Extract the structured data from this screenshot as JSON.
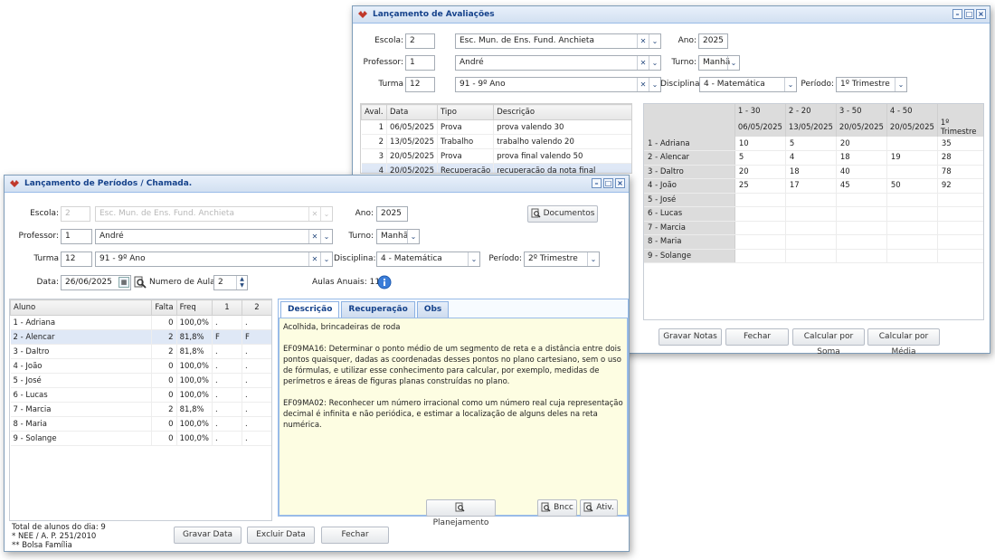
{
  "avaliacoes": {
    "title": "Lançamento de Avaliações",
    "escola_label": "Escola:",
    "escola_id": "2",
    "escola_name": "Esc. Mun. de Ens. Fund. Anchieta",
    "ano_label": "Ano:",
    "ano": "2025",
    "professor_label": "Professor:",
    "professor_id": "1",
    "professor_name": "André",
    "turno_label": "Turno:",
    "turno": "Manhã",
    "turma_label": "Turma",
    "turma_id": "12",
    "turma_name": "91 - 9º Ano",
    "disciplina_label": "Disciplina:",
    "disciplina": "4 - Matemática",
    "periodo_label": "Período:",
    "periodo": "1º Trimestre",
    "eval_headers": [
      "Aval.",
      "Data",
      "Tipo",
      "Descrição"
    ],
    "evals": [
      {
        "n": "1",
        "data": "06/05/2025",
        "tipo": "Prova",
        "desc": "prova valendo 30"
      },
      {
        "n": "2",
        "data": "13/05/2025",
        "tipo": "Trabalho",
        "desc": "trabalho valendo 20"
      },
      {
        "n": "3",
        "data": "20/05/2025",
        "tipo": "Prova",
        "desc": "prova final valendo 50"
      },
      {
        "n": "4",
        "data": "20/05/2025",
        "tipo": "Recuperação",
        "desc": "recuperação da nota final"
      }
    ],
    "grade_head1": [
      "1 - 30",
      "2 - 20",
      "3 - 50",
      "4 - 50",
      ""
    ],
    "grade_head2": [
      "06/05/2025",
      "13/05/2025",
      "20/05/2025",
      "20/05/2025",
      "1º Trimestre"
    ],
    "grades": [
      {
        "aluno": "1 - Adriana",
        "v": [
          "10",
          "5",
          "20",
          "",
          "35"
        ]
      },
      {
        "aluno": "2 - Alencar",
        "v": [
          "5",
          "4",
          "18",
          "19",
          "28"
        ]
      },
      {
        "aluno": "3 - Daltro",
        "v": [
          "20",
          "18",
          "40",
          "",
          "78"
        ]
      },
      {
        "aluno": "4 - João",
        "v": [
          "25",
          "17",
          "45",
          "50",
          "92"
        ]
      },
      {
        "aluno": "5 - José",
        "v": [
          "",
          "",
          "",
          "",
          ""
        ]
      },
      {
        "aluno": "6 - Lucas",
        "v": [
          "",
          "",
          "",
          "",
          ""
        ]
      },
      {
        "aluno": "7 - Marcia",
        "v": [
          "",
          "",
          "",
          "",
          ""
        ]
      },
      {
        "aluno": "8 - Maria",
        "v": [
          "",
          "",
          "",
          "",
          ""
        ]
      },
      {
        "aluno": "9 - Solange",
        "v": [
          "",
          "",
          "",
          "",
          ""
        ]
      }
    ],
    "btn_gravar": "Gravar Notas",
    "btn_fechar": "Fechar",
    "btn_soma": "Calcular por Soma",
    "btn_media": "Calcular por Média"
  },
  "periodos": {
    "title": "Lançamento de Períodos / Chamada.",
    "escola_label": "Escola:",
    "escola_id": "2",
    "escola_name": "Esc. Mun. de Ens. Fund. Anchieta",
    "ano_label": "Ano:",
    "ano": "2025",
    "btn_documentos": "Documentos",
    "professor_label": "Professor:",
    "professor_id": "1",
    "professor_name": "André",
    "turno_label": "Turno:",
    "turno": "Manhã",
    "turma_label": "Turma",
    "turma_id": "12",
    "turma_name": "91 - 9º Ano",
    "disciplina_label": "Disciplina:",
    "disciplina": "4 - Matemática",
    "periodo_label": "Período:",
    "periodo": "2º Trimestre",
    "data_label": "Data:",
    "data": "26/06/2025",
    "numaulas_label": "Numero de Aulas",
    "numaulas": "2",
    "aulas_anuais": "Aulas Anuais: 11",
    "att_headers": [
      "Aluno",
      "Falta",
      "Freq",
      "1",
      "2"
    ],
    "attendance": [
      {
        "aluno": "1 - Adriana",
        "falta": "0",
        "freq": "100,0%",
        "a1": ".",
        "a2": "."
      },
      {
        "aluno": "2 - Alencar",
        "falta": "2",
        "freq": "81,8%",
        "a1": "F",
        "a2": "F"
      },
      {
        "aluno": "3 - Daltro",
        "falta": "2",
        "freq": "81,8%",
        "a1": ".",
        "a2": "."
      },
      {
        "aluno": "4 - João",
        "falta": "0",
        "freq": "100,0%",
        "a1": ".",
        "a2": "."
      },
      {
        "aluno": "5 - José",
        "falta": "0",
        "freq": "100,0%",
        "a1": ".",
        "a2": "."
      },
      {
        "aluno": "6 - Lucas",
        "falta": "0",
        "freq": "100,0%",
        "a1": ".",
        "a2": "."
      },
      {
        "aluno": "7 - Marcia",
        "falta": "2",
        "freq": "81,8%",
        "a1": ".",
        "a2": "."
      },
      {
        "aluno": "8 - Maria",
        "falta": "0",
        "freq": "100,0%",
        "a1": ".",
        "a2": "."
      },
      {
        "aluno": "9 - Solange",
        "falta": "0",
        "freq": "100,0%",
        "a1": ".",
        "a2": "."
      }
    ],
    "tabs": [
      "Descrição",
      "Recuperação",
      "Obs"
    ],
    "descricao": "Acolhida, brincadeiras de roda\n\nEF09MA16: Determinar o ponto médio de um segmento de reta e a distância entre dois pontos quaisquer, dadas as coordenadas desses pontos no plano cartesiano, sem o uso de fórmulas, e utilizar esse conhecimento para calcular, por exemplo, medidas de perímetros e áreas de figuras planas construídas no plano.\n\nEF09MA02: Reconhecer um número irracional como um número real cuja representação decimal é infinita e não periódica, e estimar a localização de alguns deles na reta numérica.",
    "btn_planejamento": "Planejamento",
    "btn_bncc": "Bncc",
    "btn_ativ": "Ativ.",
    "footer_total": "Total de alunos do dia: 9",
    "footer_nee": "* NEE / A. P. 251/2010",
    "footer_bolsa": "** Bolsa Família",
    "btn_gravar": "Gravar Data",
    "btn_excluir": "Excluir Data",
    "btn_fechar": "Fechar"
  },
  "colors": {
    "title_text": "#15428b",
    "selected_row": "#dfe8f6",
    "desc_bg": "#fdfde2",
    "info_icon": "#3b7dd8"
  }
}
